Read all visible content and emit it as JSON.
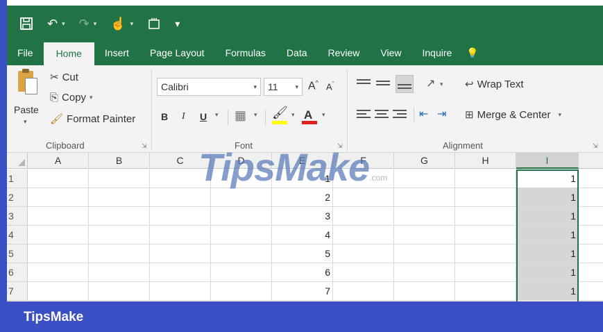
{
  "quick_access": {
    "save_icon": "save-icon",
    "undo_icon": "undo-icon",
    "redo_icon": "redo-icon",
    "touch_icon": "touch-mode-icon",
    "macro_icon": "macro-icon",
    "customize_icon": "customize-qat-icon"
  },
  "tabs": [
    "File",
    "Home",
    "Insert",
    "Page Layout",
    "Formulas",
    "Data",
    "Review",
    "View",
    "Inquire"
  ],
  "active_tab": "Home",
  "ribbon": {
    "clipboard": {
      "paste": "Paste",
      "cut": "Cut",
      "copy": "Copy",
      "format_painter": "Format Painter",
      "label": "Clipboard"
    },
    "font": {
      "name": "Calibri",
      "size": "11",
      "grow": "A",
      "shrink": "A",
      "bold": "B",
      "italic": "I",
      "underline": "U",
      "font_color": "A",
      "label": "Font"
    },
    "alignment": {
      "wrap_text": "Wrap Text",
      "merge_center": "Merge & Center",
      "label": "Alignment"
    }
  },
  "grid": {
    "columns": [
      "A",
      "B",
      "C",
      "D",
      "E",
      "F",
      "G",
      "H",
      "I"
    ],
    "selected_column": "I",
    "rows": [
      "1",
      "2",
      "3",
      "4",
      "5",
      "6",
      "7"
    ],
    "column_E": [
      "1",
      "2",
      "3",
      "4",
      "5",
      "6",
      "7"
    ],
    "column_I": [
      "1",
      "1",
      "1",
      "1",
      "1",
      "1",
      "1"
    ]
  },
  "watermark": {
    "text": "TipsMake",
    "suffix": ".com"
  },
  "footer": {
    "brand": "TipsMake"
  },
  "colors": {
    "excel_green": "#217346",
    "banner_blue": "#3a4fc4"
  }
}
